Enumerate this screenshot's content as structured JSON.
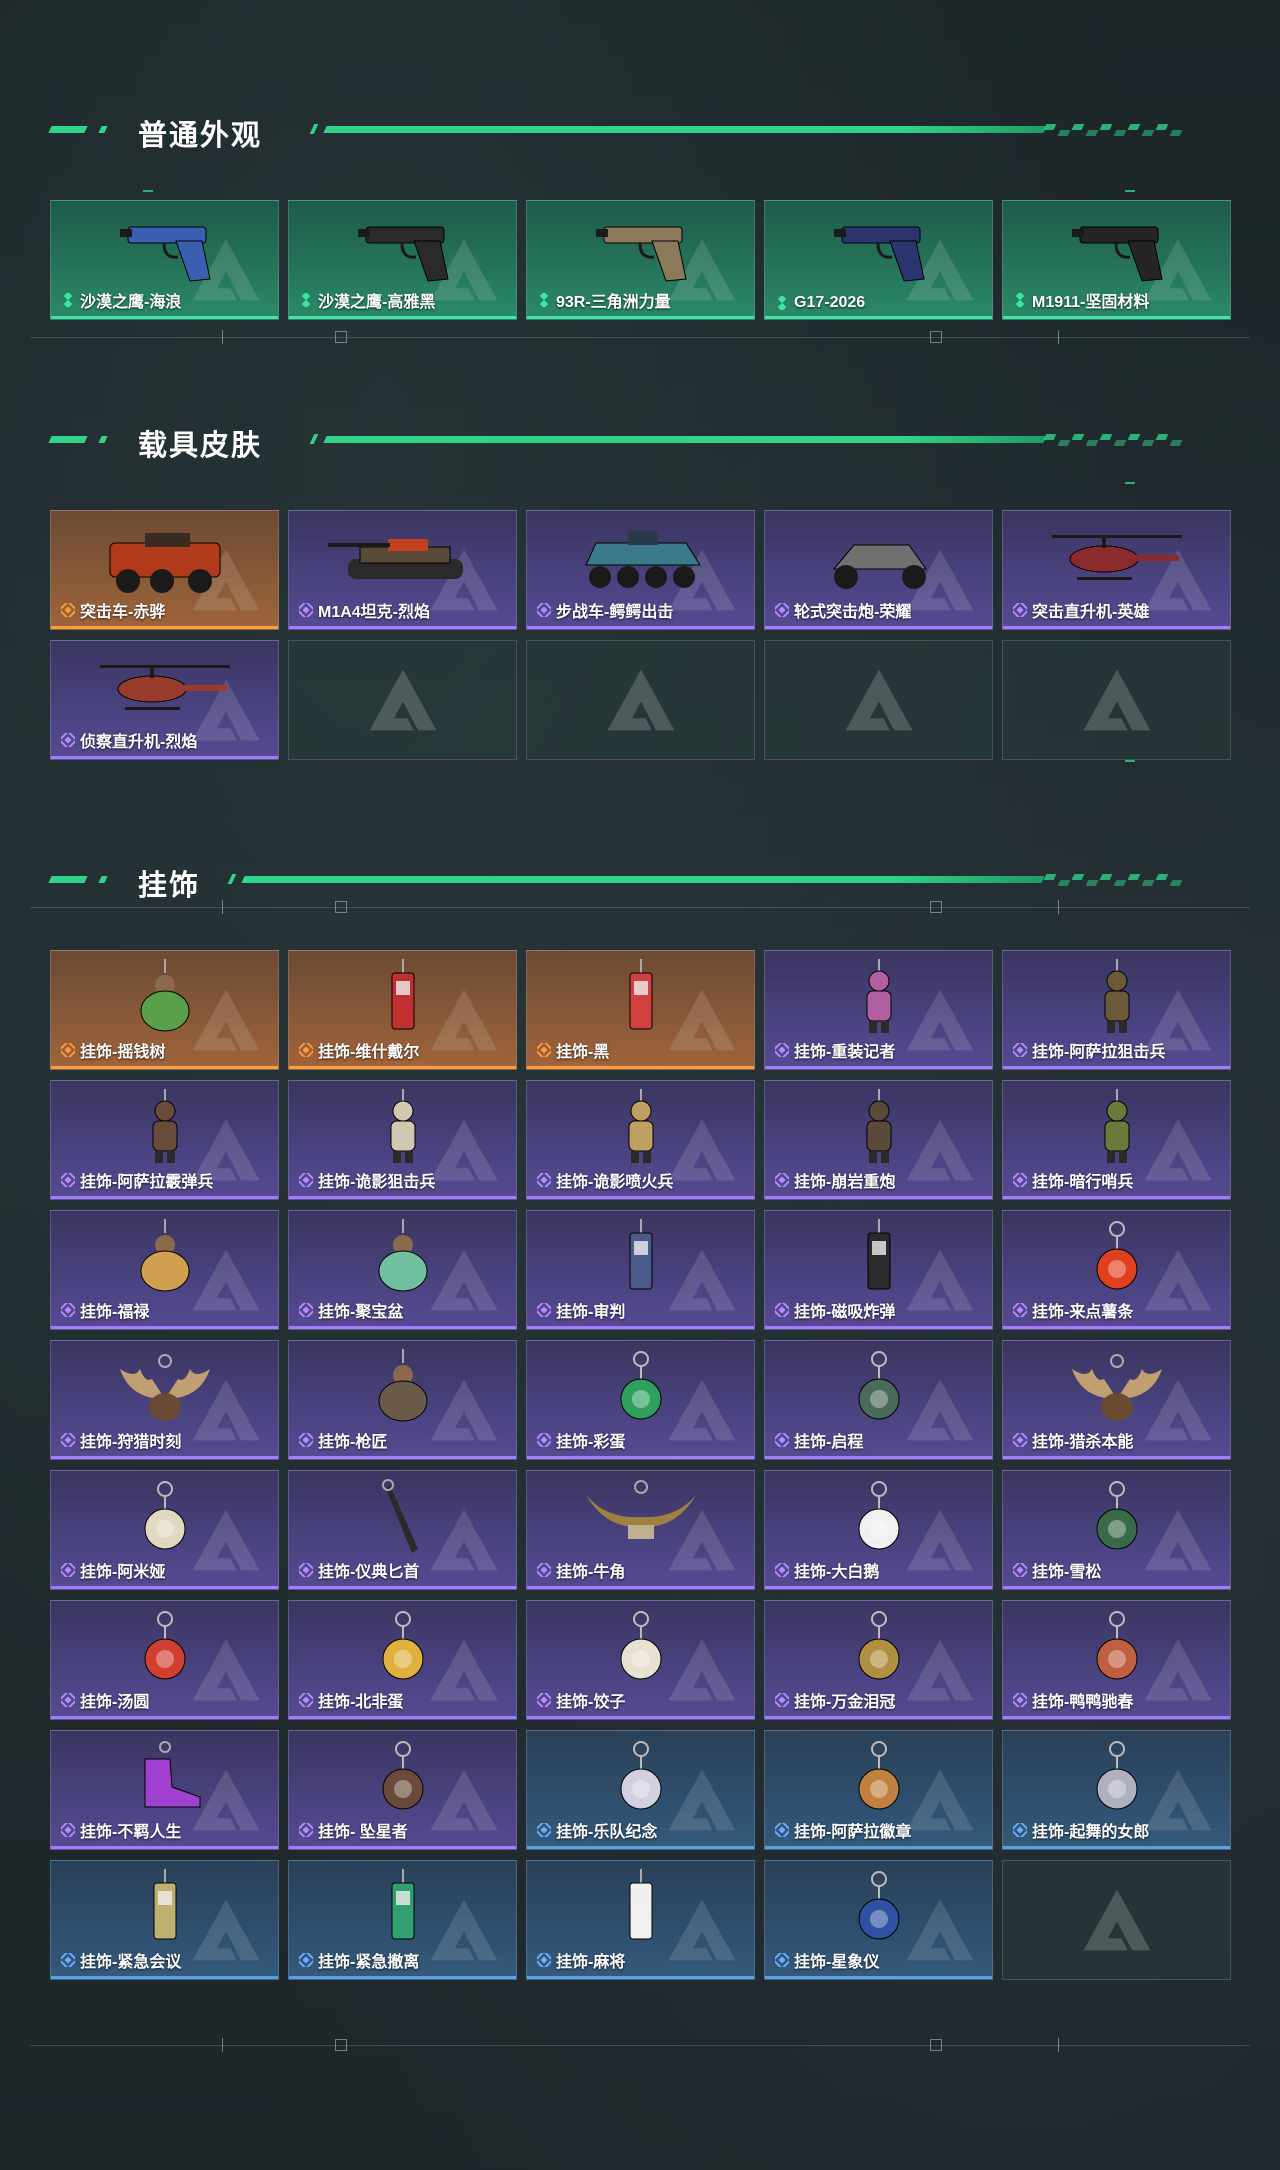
{
  "sections": [
    {
      "title": "普通外观",
      "items": [
        {
          "label": "沙漠之鹰-海浪",
          "rarity": "green",
          "art": "pistol-icon",
          "color": "#3a5fb0"
        },
        {
          "label": "沙漠之鹰-高雅黑",
          "rarity": "green",
          "art": "pistol-icon",
          "color": "#2a2a2a"
        },
        {
          "label": "93R-三角洲力量",
          "rarity": "green",
          "art": "pistol-icon",
          "color": "#8a7a5a"
        },
        {
          "label": "G17-2026",
          "rarity": "green",
          "art": "pistol-icon",
          "color": "#2a3570"
        },
        {
          "label": "M1911-坚固材料",
          "rarity": "green",
          "art": "pistol-icon",
          "color": "#252525"
        }
      ]
    },
    {
      "title": "载具皮肤",
      "items": [
        {
          "label": "突击车-赤骅",
          "rarity": "orange",
          "art": "truck-icon",
          "color": "#b03a1a"
        },
        {
          "label": "M1A4坦克-烈焰",
          "rarity": "purple",
          "art": "tank-icon",
          "color": "#5a4a3a"
        },
        {
          "label": "步战车-鳄鳄出击",
          "rarity": "purple",
          "art": "apc-icon",
          "color": "#3a7a8a"
        },
        {
          "label": "轮式突击炮-荣耀",
          "rarity": "purple",
          "art": "buggy-icon",
          "color": "#707070"
        },
        {
          "label": "突击直升机-英雄",
          "rarity": "purple",
          "art": "helicopter-icon",
          "color": "#8a2a2a"
        },
        {
          "label": "侦察直升机-烈焰",
          "rarity": "purple",
          "art": "helicopter-icon",
          "color": "#9a3a2a"
        },
        {
          "label": "",
          "rarity": "empty"
        },
        {
          "label": "",
          "rarity": "empty"
        },
        {
          "label": "",
          "rarity": "empty"
        },
        {
          "label": "",
          "rarity": "empty"
        }
      ]
    },
    {
      "title": "挂饰",
      "items": [
        {
          "label": "挂饰-摇钱树",
          "rarity": "orange",
          "art": "charm-icon",
          "color": "#5aa04a"
        },
        {
          "label": "挂饰-维什戴尔",
          "rarity": "orange",
          "art": "charm-tag-icon",
          "color": "#c03030"
        },
        {
          "label": "挂饰-黑",
          "rarity": "orange",
          "art": "charm-tag-icon",
          "color": "#d04040"
        },
        {
          "label": "挂饰-重装记者",
          "rarity": "purple",
          "art": "charm-figure-icon",
          "color": "#b060a0"
        },
        {
          "label": "挂饰-阿萨拉狙击兵",
          "rarity": "purple",
          "art": "charm-figure-icon",
          "color": "#6a5a3a"
        },
        {
          "label": "挂饰-阿萨拉霰弹兵",
          "rarity": "purple",
          "art": "charm-figure-icon",
          "color": "#6a4a3a"
        },
        {
          "label": "挂饰-诡影狙击兵",
          "rarity": "purple",
          "art": "charm-figure-icon",
          "color": "#d0c8b0"
        },
        {
          "label": "挂饰-诡影喷火兵",
          "rarity": "purple",
          "art": "charm-figure-icon",
          "color": "#c0a060"
        },
        {
          "label": "挂饰-崩岩重炮",
          "rarity": "purple",
          "art": "charm-figure-icon",
          "color": "#5a4a3a"
        },
        {
          "label": "挂饰-暗行哨兵",
          "rarity": "purple",
          "art": "charm-figure-icon",
          "color": "#6a7a3a"
        },
        {
          "label": "挂饰-福禄",
          "rarity": "purple",
          "art": "charm-icon",
          "color": "#d0a050"
        },
        {
          "label": "挂饰-聚宝盆",
          "rarity": "purple",
          "art": "charm-icon",
          "color": "#70c0a0"
        },
        {
          "label": "挂饰-审判",
          "rarity": "purple",
          "art": "charm-tag-icon",
          "color": "#4a5a8a"
        },
        {
          "label": "挂饰-磁吸炸弹",
          "rarity": "purple",
          "art": "charm-tag-icon",
          "color": "#2a2a2a"
        },
        {
          "label": "挂饰-来点薯条",
          "rarity": "purple",
          "art": "charm-ring-icon",
          "color": "#e04020"
        },
        {
          "label": "挂饰-狩猎时刻",
          "rarity": "purple",
          "art": "antler-icon",
          "color": "#c0a070"
        },
        {
          "label": "挂饰-枪匠",
          "rarity": "purple",
          "art": "charm-icon",
          "color": "#6a5a4a"
        },
        {
          "label": "挂饰-彩蛋",
          "rarity": "purple",
          "art": "charm-ring-icon",
          "color": "#30a060"
        },
        {
          "label": "挂饰-启程",
          "rarity": "purple",
          "art": "charm-ring-icon",
          "color": "#4a6a5a"
        },
        {
          "label": "挂饰-猎杀本能",
          "rarity": "purple",
          "art": "antler-icon",
          "color": "#c0a070"
        },
        {
          "label": "挂饰-阿米娅",
          "rarity": "purple",
          "art": "charm-ring-icon",
          "color": "#e0d8c0"
        },
        {
          "label": "挂饰-仪典匕首",
          "rarity": "purple",
          "art": "dagger-icon",
          "color": "#2a2a2a"
        },
        {
          "label": "挂饰-牛角",
          "rarity": "purple",
          "art": "horn-icon",
          "color": "#a08040"
        },
        {
          "label": "挂饰-大白鹅",
          "rarity": "purple",
          "art": "charm-ring-icon",
          "color": "#f0f0f0"
        },
        {
          "label": "挂饰-雪松",
          "rarity": "purple",
          "art": "charm-ring-icon",
          "color": "#3a6a4a"
        },
        {
          "label": "挂饰-汤圆",
          "rarity": "purple",
          "art": "charm-ring-icon",
          "color": "#d04030"
        },
        {
          "label": "挂饰-北非蛋",
          "rarity": "purple",
          "art": "charm-ring-icon",
          "color": "#e0b040"
        },
        {
          "label": "挂饰-饺子",
          "rarity": "purple",
          "art": "charm-ring-icon",
          "color": "#e8e0d0"
        },
        {
          "label": "挂饰-万金泪冠",
          "rarity": "purple",
          "art": "charm-ring-icon",
          "color": "#b09040"
        },
        {
          "label": "挂饰-鸭鸭驰春",
          "rarity": "purple",
          "art": "charm-ring-icon",
          "color": "#c06040"
        },
        {
          "label": "挂饰-不羁人生",
          "rarity": "purple",
          "art": "shoe-icon",
          "color": "#a040d0"
        },
        {
          "label": "挂饰- 坠星者",
          "rarity": "purple",
          "art": "charm-ring-icon",
          "color": "#6a4a3a"
        },
        {
          "label": "挂饰-乐队纪念",
          "rarity": "blue",
          "art": "charm-ring-icon",
          "color": "#d0d0e0"
        },
        {
          "label": "挂饰-阿萨拉徽章",
          "rarity": "blue",
          "art": "charm-ring-icon",
          "color": "#c08040"
        },
        {
          "label": "挂饰-起舞的女郎",
          "rarity": "blue",
          "art": "charm-ring-icon",
          "color": "#b0b0c0"
        },
        {
          "label": "挂饰-紧急会议",
          "rarity": "blue",
          "art": "charm-tag-icon",
          "color": "#c0b070"
        },
        {
          "label": "挂饰-紧急撤离",
          "rarity": "blue",
          "art": "charm-tag-icon",
          "color": "#30a070"
        },
        {
          "label": "挂饰-麻将",
          "rarity": "blue",
          "art": "charm-tag-icon",
          "color": "#f0f0f0"
        },
        {
          "label": "挂饰-星象仪",
          "rarity": "blue",
          "art": "charm-ring-icon",
          "color": "#3050a0"
        },
        {
          "label": "",
          "rarity": "empty"
        }
      ]
    }
  ],
  "colors": {
    "accent": "#2fd48a",
    "green": "#3ee6a0",
    "purple": "#a57bff",
    "orange": "#ff9b3a",
    "blue": "#5aa0e6"
  }
}
